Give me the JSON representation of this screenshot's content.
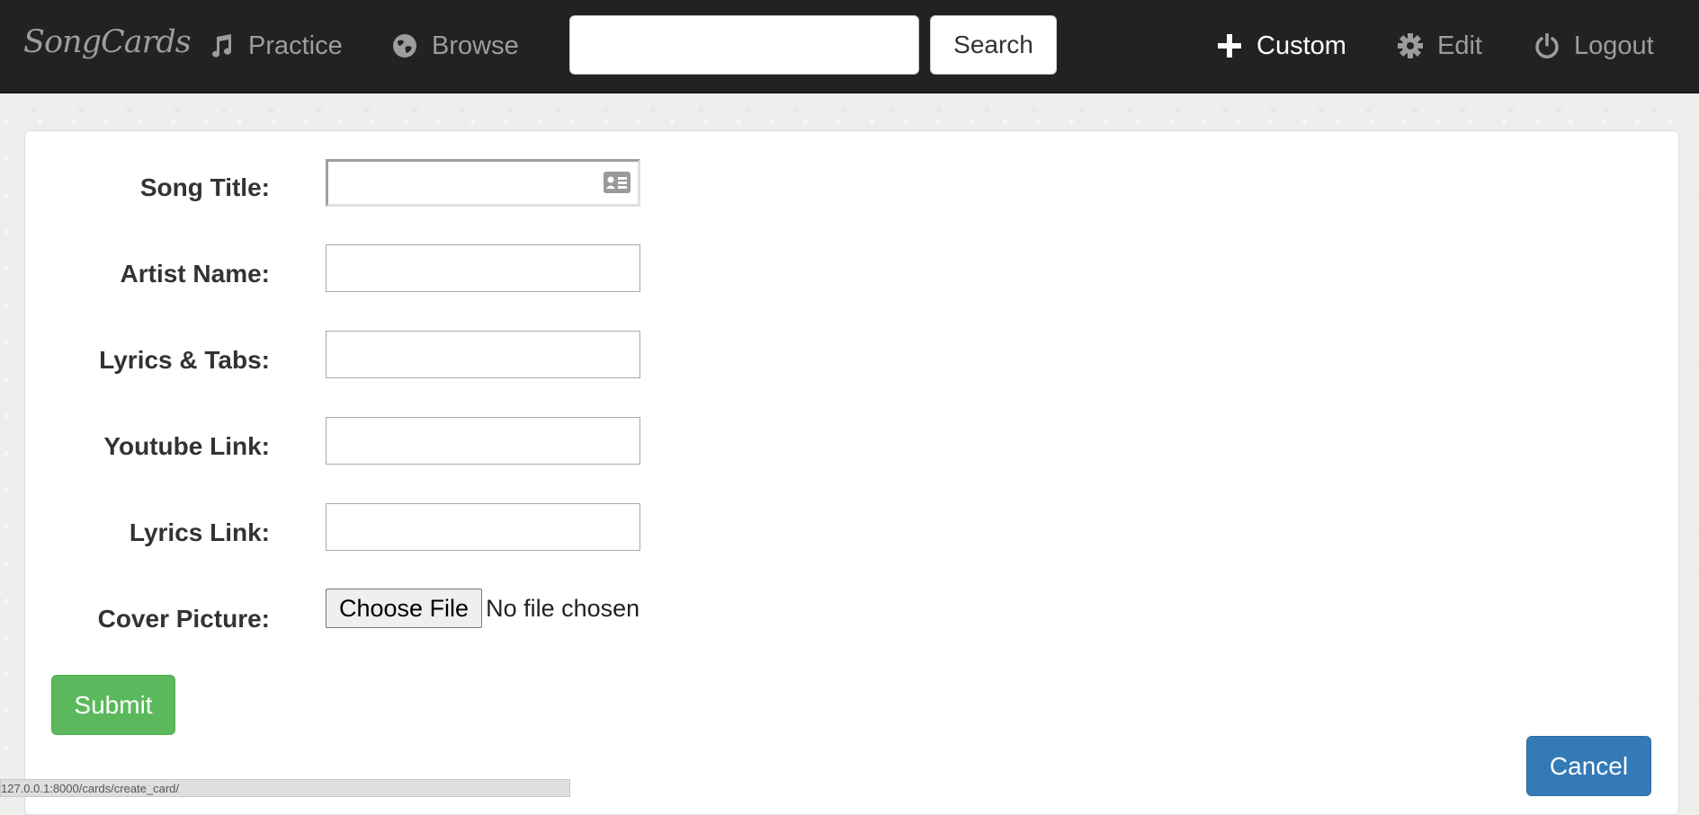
{
  "navbar": {
    "brand": "SongCards",
    "items": [
      {
        "label": "Practice",
        "icon": "music-note-icon"
      },
      {
        "label": "Browse",
        "icon": "globe-icon"
      },
      {
        "label": "Custom",
        "icon": "plus-icon"
      },
      {
        "label": "Edit",
        "icon": "gear-icon"
      },
      {
        "label": "Logout",
        "icon": "power-icon"
      }
    ],
    "search": {
      "value": "",
      "placeholder": "",
      "button_label": "Search"
    }
  },
  "form": {
    "fields": [
      {
        "label": "Song Title:",
        "value": ""
      },
      {
        "label": "Artist Name:",
        "value": ""
      },
      {
        "label": "Lyrics & Tabs:",
        "value": ""
      },
      {
        "label": "Youtube Link:",
        "value": ""
      },
      {
        "label": "Lyrics Link:",
        "value": ""
      }
    ],
    "cover": {
      "label": "Cover Picture:",
      "button_label": "Choose File",
      "status": "No file chosen"
    },
    "submit_label": "Submit",
    "cancel_label": "Cancel"
  },
  "statusbar": {
    "url": "127.0.0.1:8000/cards/create_card/"
  },
  "colors": {
    "navbar": "#222222",
    "submit": "#5cb85c",
    "cancel": "#337ab7"
  }
}
